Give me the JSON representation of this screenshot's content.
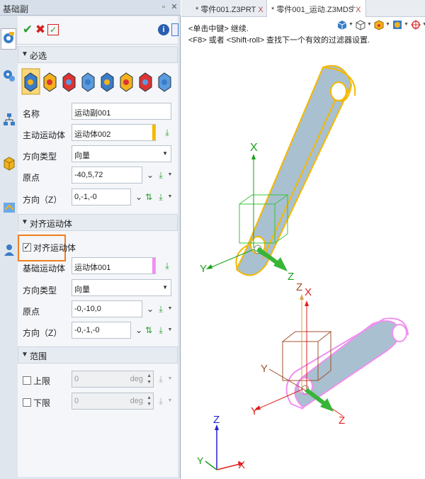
{
  "panel": {
    "title": "基础副",
    "pin_icon": "pin-icon",
    "close_symbol": "✕"
  },
  "toolbar": {
    "ok_icon": "checkmark-icon",
    "cancel_icon": "cancel-icon",
    "apply_icon": "apply-icon",
    "info_icon": "info-icon",
    "doc_icon": "document-icon"
  },
  "required": {
    "header": "必选",
    "joint_types": [
      "revolute",
      "prismatic",
      "cylindrical",
      "screw",
      "spherical",
      "planar",
      "universal",
      "fixed"
    ],
    "name_label": "名称",
    "name_value": "运动副001",
    "main_body_label": "主动运动体",
    "main_body_value": "运动体002",
    "dir_type_label": "方向类型",
    "dir_type_value": "向量",
    "origin_label": "原点",
    "origin_value": "-40,5,72",
    "direction_label": "方向（Z）",
    "direction_value": "0,-1,-0"
  },
  "align": {
    "header": "对齐运动体",
    "checkbox_label": "对齐运动体",
    "checkbox_checked": true,
    "base_body_label": "基础运动体",
    "base_body_value": "运动体001",
    "dir_type_label": "方向类型",
    "dir_type_value": "向量",
    "origin_label": "原点",
    "origin_value": "-0,-10,0",
    "direction_label": "方向（Z）",
    "direction_value": "-0,-1,-0"
  },
  "range": {
    "header": "范围",
    "upper_label": "上限",
    "upper_value": "0",
    "upper_unit": "deg",
    "lower_label": "下限",
    "lower_value": "0",
    "lower_unit": "deg"
  },
  "tabs": [
    {
      "label": "* 零件001.Z3PRT",
      "close": "X",
      "active": false
    },
    {
      "label": "* 零件001_运动.Z3MDS",
      "close": "X",
      "active": true
    }
  ],
  "new_tab": "+",
  "viewport": {
    "hint1": "<单击中键> 继续.",
    "hint2": "<F8> 或者 <Shift-roll> 查找下一个有效的过滤器设置.",
    "axes": {
      "x": "X",
      "y": "Y",
      "z": "Z"
    },
    "colors": {
      "part_fill": "#b5cbd9",
      "highlight_yellow": "#f5b800",
      "highlight_pink": "#f08ff0",
      "axis_x": "#e0201e",
      "axis_y": "#1aa01a",
      "axis_z": "#2020d0",
      "arrow_green": "#37b537",
      "callout_orange": "#f07f1e"
    }
  }
}
